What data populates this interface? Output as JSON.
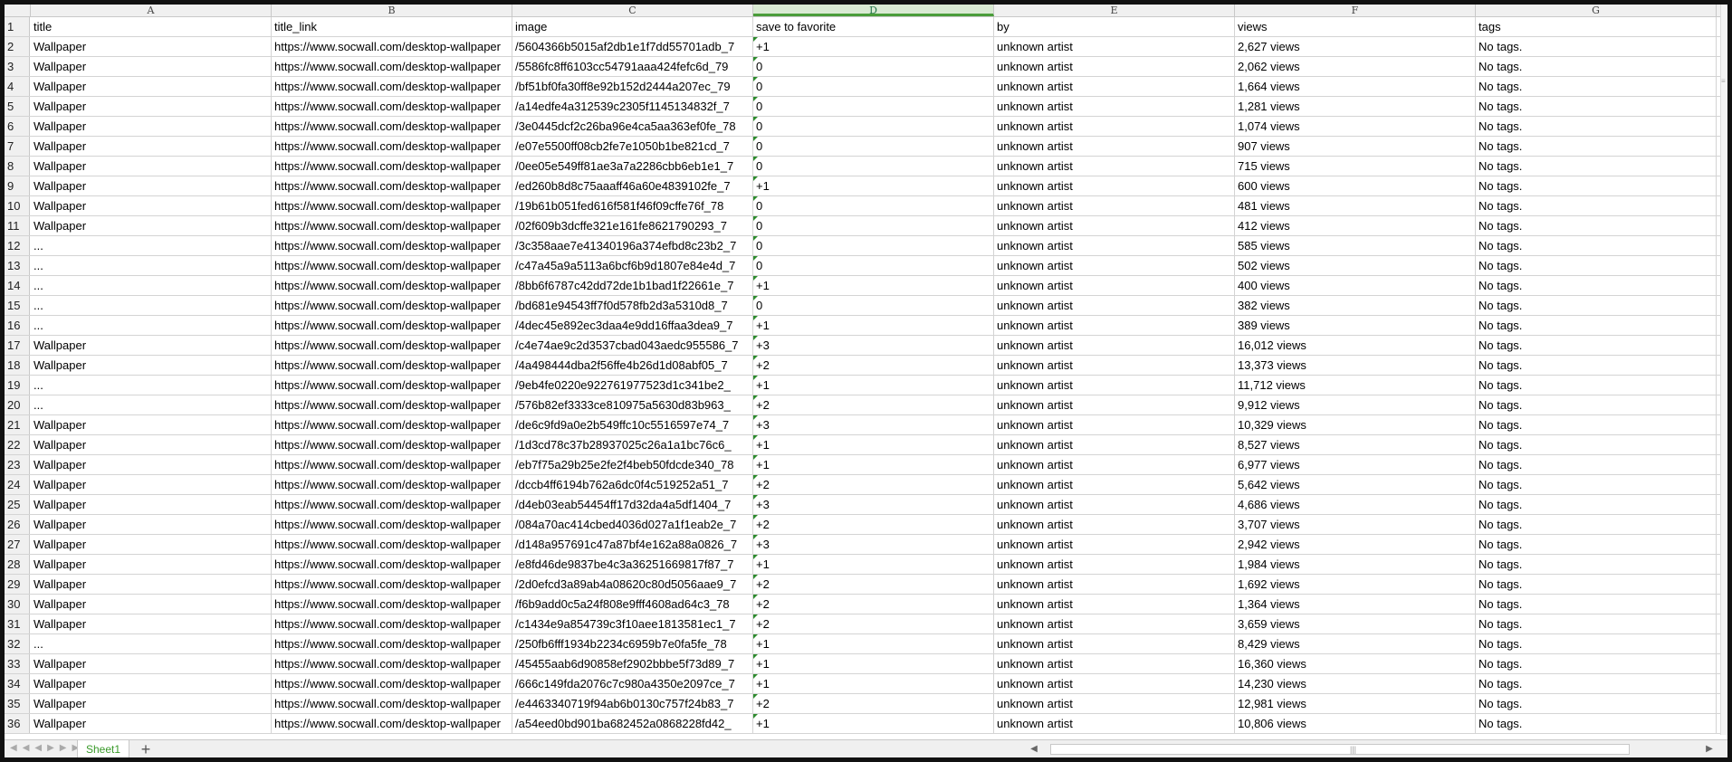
{
  "columns": [
    {
      "letter": "A",
      "width": 266
    },
    {
      "letter": "B",
      "width": 266
    },
    {
      "letter": "C",
      "width": 266
    },
    {
      "letter": "D",
      "width": 266,
      "selected": true
    },
    {
      "letter": "E",
      "width": 266
    },
    {
      "letter": "F",
      "width": 266
    },
    {
      "letter": "G",
      "width": 266
    }
  ],
  "header_row": [
    "title",
    "title_link",
    "image",
    "save to favorite",
    "by",
    "views",
    "tags"
  ],
  "rows": [
    [
      "Wallpaper",
      "https://www.socwall.com/desktop-wallpaper",
      "/5604366b5015af2db1e1f7dd55701adb_7",
      "+1",
      "unknown artist",
      "2,627 views",
      "No tags."
    ],
    [
      "Wallpaper",
      "https://www.socwall.com/desktop-wallpaper",
      "/5586fc8ff6103cc54791aaa424fefc6d_79",
      "0",
      "unknown artist",
      "2,062 views",
      "No tags."
    ],
    [
      "Wallpaper",
      "https://www.socwall.com/desktop-wallpaper",
      "/bf51bf0fa30ff8e92b152d2444a207ec_79",
      "0",
      "unknown artist",
      "1,664 views",
      "No tags."
    ],
    [
      "Wallpaper",
      "https://www.socwall.com/desktop-wallpaper",
      "/a14edfe4a312539c2305f1145134832f_7",
      "0",
      "unknown artist",
      "1,281 views",
      "No tags."
    ],
    [
      "Wallpaper",
      "https://www.socwall.com/desktop-wallpaper",
      "/3e0445dcf2c26ba96e4ca5aa363ef0fe_78",
      "0",
      "unknown artist",
      "1,074 views",
      "No tags."
    ],
    [
      "Wallpaper",
      "https://www.socwall.com/desktop-wallpaper",
      "/e07e5500ff08cb2fe7e1050b1be821cd_7",
      "0",
      "unknown artist",
      "907 views",
      "No tags."
    ],
    [
      "Wallpaper",
      "https://www.socwall.com/desktop-wallpaper",
      "/0ee05e549ff81ae3a7a2286cbb6eb1e1_7",
      "0",
      "unknown artist",
      "715 views",
      "No tags."
    ],
    [
      "Wallpaper",
      "https://www.socwall.com/desktop-wallpaper",
      "/ed260b8d8c75aaaff46a60e4839102fe_7",
      "+1",
      "unknown artist",
      "600 views",
      "No tags."
    ],
    [
      "Wallpaper",
      "https://www.socwall.com/desktop-wallpaper",
      "/19b61b051fed616f581f46f09cffe76f_78",
      "0",
      "unknown artist",
      "481 views",
      "No tags."
    ],
    [
      "Wallpaper",
      "https://www.socwall.com/desktop-wallpaper",
      "/02f609b3dcffe321e161fe8621790293_7",
      "0",
      "unknown artist",
      "412 views",
      "No tags."
    ],
    [
      "...",
      "https://www.socwall.com/desktop-wallpaper",
      "/3c358aae7e41340196a374efbd8c23b2_7",
      "0",
      "unknown artist",
      "585 views",
      "No tags."
    ],
    [
      "...",
      "https://www.socwall.com/desktop-wallpaper",
      "/c47a45a9a5113a6bcf6b9d1807e84e4d_7",
      "0",
      "unknown artist",
      "502 views",
      "No tags."
    ],
    [
      "...",
      "https://www.socwall.com/desktop-wallpaper",
      "/8bb6f6787c42dd72de1b1bad1f22661e_7",
      "+1",
      "unknown artist",
      "400 views",
      "No tags."
    ],
    [
      "...",
      "https://www.socwall.com/desktop-wallpaper",
      "/bd681e94543ff7f0d578fb2d3a5310d8_7",
      "0",
      "unknown artist",
      "382 views",
      "No tags."
    ],
    [
      "...",
      "https://www.socwall.com/desktop-wallpaper",
      "/4dec45e892ec3daa4e9dd16ffaa3dea9_7",
      "+1",
      "unknown artist",
      "389 views",
      "No tags."
    ],
    [
      "Wallpaper",
      "https://www.socwall.com/desktop-wallpaper",
      "/c4e74ae9c2d3537cbad043aedc955586_7",
      "+3",
      "unknown artist",
      "16,012 views",
      "No tags."
    ],
    [
      "Wallpaper",
      "https://www.socwall.com/desktop-wallpaper",
      "/4a498444dba2f56ffe4b26d1d08abf05_7",
      "+2",
      "unknown artist",
      "13,373 views",
      "No tags."
    ],
    [
      "...",
      "https://www.socwall.com/desktop-wallpaper",
      "/9eb4fe0220e922761977523d1c341be2_",
      "+1",
      "unknown artist",
      "11,712 views",
      "No tags."
    ],
    [
      "...",
      "https://www.socwall.com/desktop-wallpaper",
      "/576b82ef3333ce810975a5630d83b963_",
      "+2",
      "unknown artist",
      "9,912 views",
      "No tags."
    ],
    [
      "Wallpaper",
      "https://www.socwall.com/desktop-wallpaper",
      "/de6c9fd9a0e2b549ffc10c5516597e74_7",
      "+3",
      "unknown artist",
      "10,329 views",
      "No tags."
    ],
    [
      "Wallpaper",
      "https://www.socwall.com/desktop-wallpaper",
      "/1d3cd78c37b28937025c26a1a1bc76c6_",
      "+1",
      "unknown artist",
      "8,527 views",
      "No tags."
    ],
    [
      "Wallpaper",
      "https://www.socwall.com/desktop-wallpaper",
      "/eb7f75a29b25e2fe2f4beb50fdcde340_78",
      "+1",
      "unknown artist",
      "6,977 views",
      "No tags."
    ],
    [
      "Wallpaper",
      "https://www.socwall.com/desktop-wallpaper",
      "/dccb4ff6194b762a6dc0f4c519252a51_7",
      "+2",
      "unknown artist",
      "5,642 views",
      "No tags."
    ],
    [
      "Wallpaper",
      "https://www.socwall.com/desktop-wallpaper",
      "/d4eb03eab54454ff17d32da4a5df1404_7",
      "+3",
      "unknown artist",
      "4,686 views",
      "No tags."
    ],
    [
      "Wallpaper",
      "https://www.socwall.com/desktop-wallpaper",
      "/084a70ac414cbed4036d027a1f1eab2e_7",
      "+2",
      "unknown artist",
      "3,707 views",
      "No tags."
    ],
    [
      "Wallpaper",
      "https://www.socwall.com/desktop-wallpaper",
      "/d148a957691c47a87bf4e162a88a0826_7",
      "+3",
      "unknown artist",
      "2,942 views",
      "No tags."
    ],
    [
      "Wallpaper",
      "https://www.socwall.com/desktop-wallpaper",
      "/e8fd46de9837be4c3a36251669817f87_7",
      "+1",
      "unknown artist",
      "1,984 views",
      "No tags."
    ],
    [
      "Wallpaper",
      "https://www.socwall.com/desktop-wallpaper",
      "/2d0efcd3a89ab4a08620c80d5056aae9_7",
      "+2",
      "unknown artist",
      "1,692 views",
      "No tags."
    ],
    [
      "Wallpaper",
      "https://www.socwall.com/desktop-wallpaper",
      "/f6b9add0c5a24f808e9fff4608ad64c3_78",
      "+2",
      "unknown artist",
      "1,364 views",
      "No tags."
    ],
    [
      "Wallpaper",
      "https://www.socwall.com/desktop-wallpaper",
      "/c1434e9a854739c3f10aee1813581ec1_7",
      "+2",
      "unknown artist",
      "3,659 views",
      "No tags."
    ],
    [
      "...",
      "https://www.socwall.com/desktop-wallpaper",
      "/250fb6fff1934b2234c6959b7e0fa5fe_78",
      "+1",
      "unknown artist",
      "8,429 views",
      "No tags."
    ],
    [
      "Wallpaper",
      "https://www.socwall.com/desktop-wallpaper",
      "/45455aab6d90858ef2902bbbe5f73d89_7",
      "+1",
      "unknown artist",
      "16,360 views",
      "No tags."
    ],
    [
      "Wallpaper",
      "https://www.socwall.com/desktop-wallpaper",
      "/666c149fda2076c7c980a4350e2097ce_7",
      "+1",
      "unknown artist",
      "14,230 views",
      "No tags."
    ],
    [
      "Wallpaper",
      "https://www.socwall.com/desktop-wallpaper",
      "/e4463340719f94ab6b0130c757f24b83_7",
      "+2",
      "unknown artist",
      "12,981 views",
      "No tags."
    ],
    [
      "Wallpaper",
      "https://www.socwall.com/desktop-wallpaper",
      "/a54eed0bd901ba682452a0868228fd42_",
      "+1",
      "unknown artist",
      "10,806 views",
      "No tags."
    ]
  ],
  "sheet_tabs": [
    "Sheet1"
  ],
  "add_sheet_label": "+",
  "colors": {
    "selected_header_bg": "#d9ead3",
    "selected_header_text": "#217346",
    "sheet_tab_text": "#3a9a2a",
    "text_flag": "#2e8b2e"
  }
}
